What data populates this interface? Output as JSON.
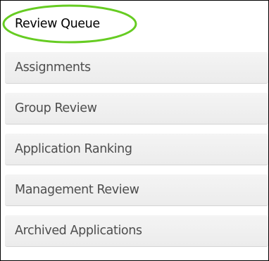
{
  "nav": {
    "items": [
      {
        "label": "Review Queue",
        "active": true
      },
      {
        "label": "Assignments",
        "active": false
      },
      {
        "label": "Group Review",
        "active": false
      },
      {
        "label": "Application Ranking",
        "active": false
      },
      {
        "label": "Management Review",
        "active": false
      },
      {
        "label": "Archived Applications",
        "active": false
      }
    ]
  },
  "annotation": {
    "highlight_color": "#66cc22"
  }
}
